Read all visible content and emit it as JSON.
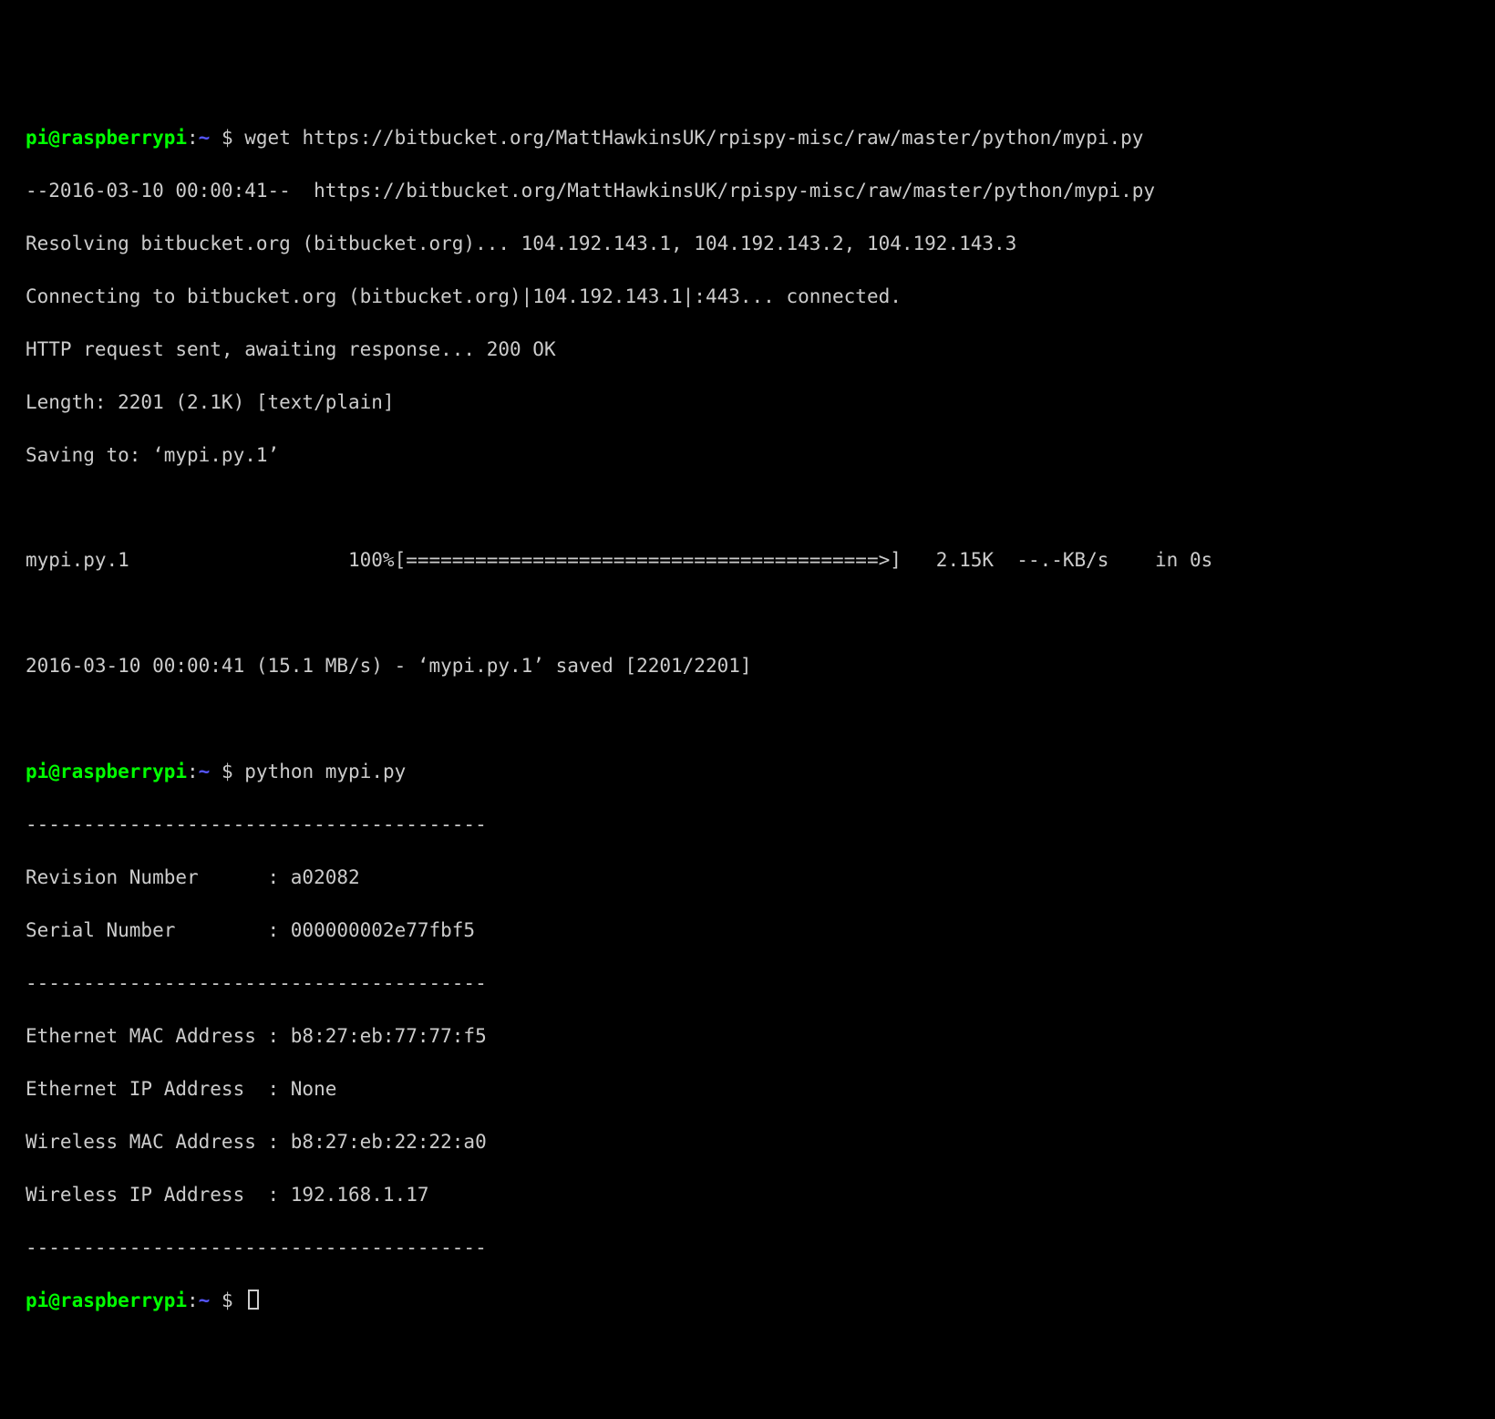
{
  "prompt": {
    "user_host": "pi@raspberrypi",
    "sep1": ":",
    "cwd": "~",
    "dollar": " $ "
  },
  "cmd1": "wget https://bitbucket.org/MattHawkinsUK/rpispy-misc/raw/master/python/mypi.py",
  "wget": {
    "l1": "--2016-03-10 00:00:41--  https://bitbucket.org/MattHawkinsUK/rpispy-misc/raw/master/python/mypi.py",
    "l2": "Resolving bitbucket.org (bitbucket.org)... 104.192.143.1, 104.192.143.2, 104.192.143.3",
    "l3": "Connecting to bitbucket.org (bitbucket.org)|104.192.143.1|:443... connected.",
    "l4": "HTTP request sent, awaiting response... 200 OK",
    "l5": "Length: 2201 (2.1K) [text/plain]",
    "l6": "Saving to: ‘mypi.py.1’",
    "progress": "mypi.py.1                   100%[=========================================>]   2.15K  --.-KB/s    in 0s",
    "done": "2016-03-10 00:00:41 (15.1 MB/s) - ‘mypi.py.1’ saved [2201/2201]"
  },
  "cmd2": "python mypi.py",
  "mypi": {
    "sep": "----------------------------------------",
    "rev": "Revision Number      : a02082",
    "ser": "Serial Number        : 000000002e77fbf5",
    "emac": "Ethernet MAC Address : b8:27:eb:77:77:f5",
    "eip": "Ethernet IP Address  : None",
    "wmac": "Wireless MAC Address : b8:27:eb:22:22:a0",
    "wip": "Wireless IP Address  : 192.168.1.17"
  }
}
